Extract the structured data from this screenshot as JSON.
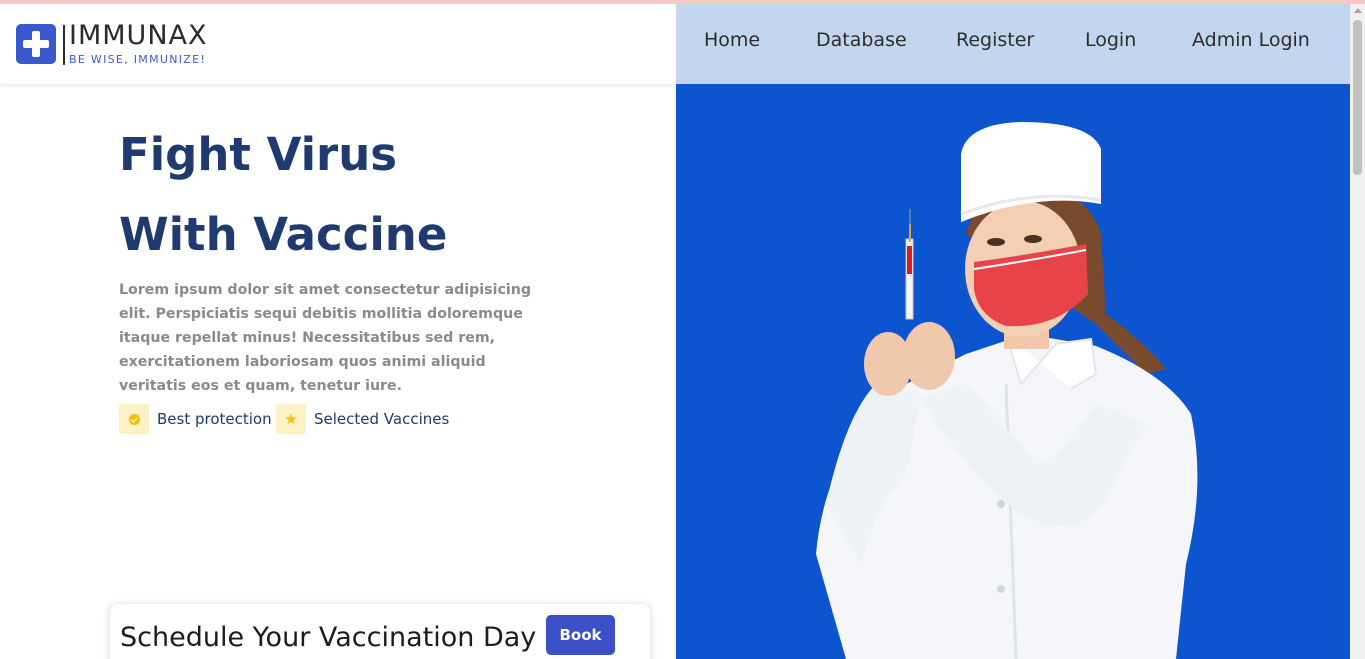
{
  "brand": {
    "name": "IMMUNAX",
    "tagline": "BE WISE, IMMUNIZE!",
    "logo_icon": "plus-cross-icon",
    "accent_color": "#3b59cf"
  },
  "nav": {
    "items": [
      {
        "label": "Home"
      },
      {
        "label": "Database"
      },
      {
        "label": "Register"
      },
      {
        "label": "Login"
      },
      {
        "label": "Admin Login"
      }
    ],
    "background_color": "#c2d6f0"
  },
  "hero": {
    "title_line1": "Fight Virus",
    "title_line2": "With Vaccine",
    "description": "Lorem ipsum dolor sit amet consectetur adipisicing elit. Perspiciatis sequi debitis mollitia doloremque itaque repellat minus! Necessitatibus sed rem, exercitationem laboriosam quos animi aliquid veritatis eos et quam, tenetur iure.",
    "features": [
      {
        "label": "Best protection",
        "icon": "check-circle-icon"
      },
      {
        "label": "Selected Vaccines",
        "icon": "star-icon"
      }
    ],
    "title_color": "#1e3a6e",
    "image_background": "#0c55cf"
  },
  "schedule": {
    "title": "Schedule Your Vaccination Day",
    "button_label": "Book",
    "button_color": "#3b4fc6"
  }
}
